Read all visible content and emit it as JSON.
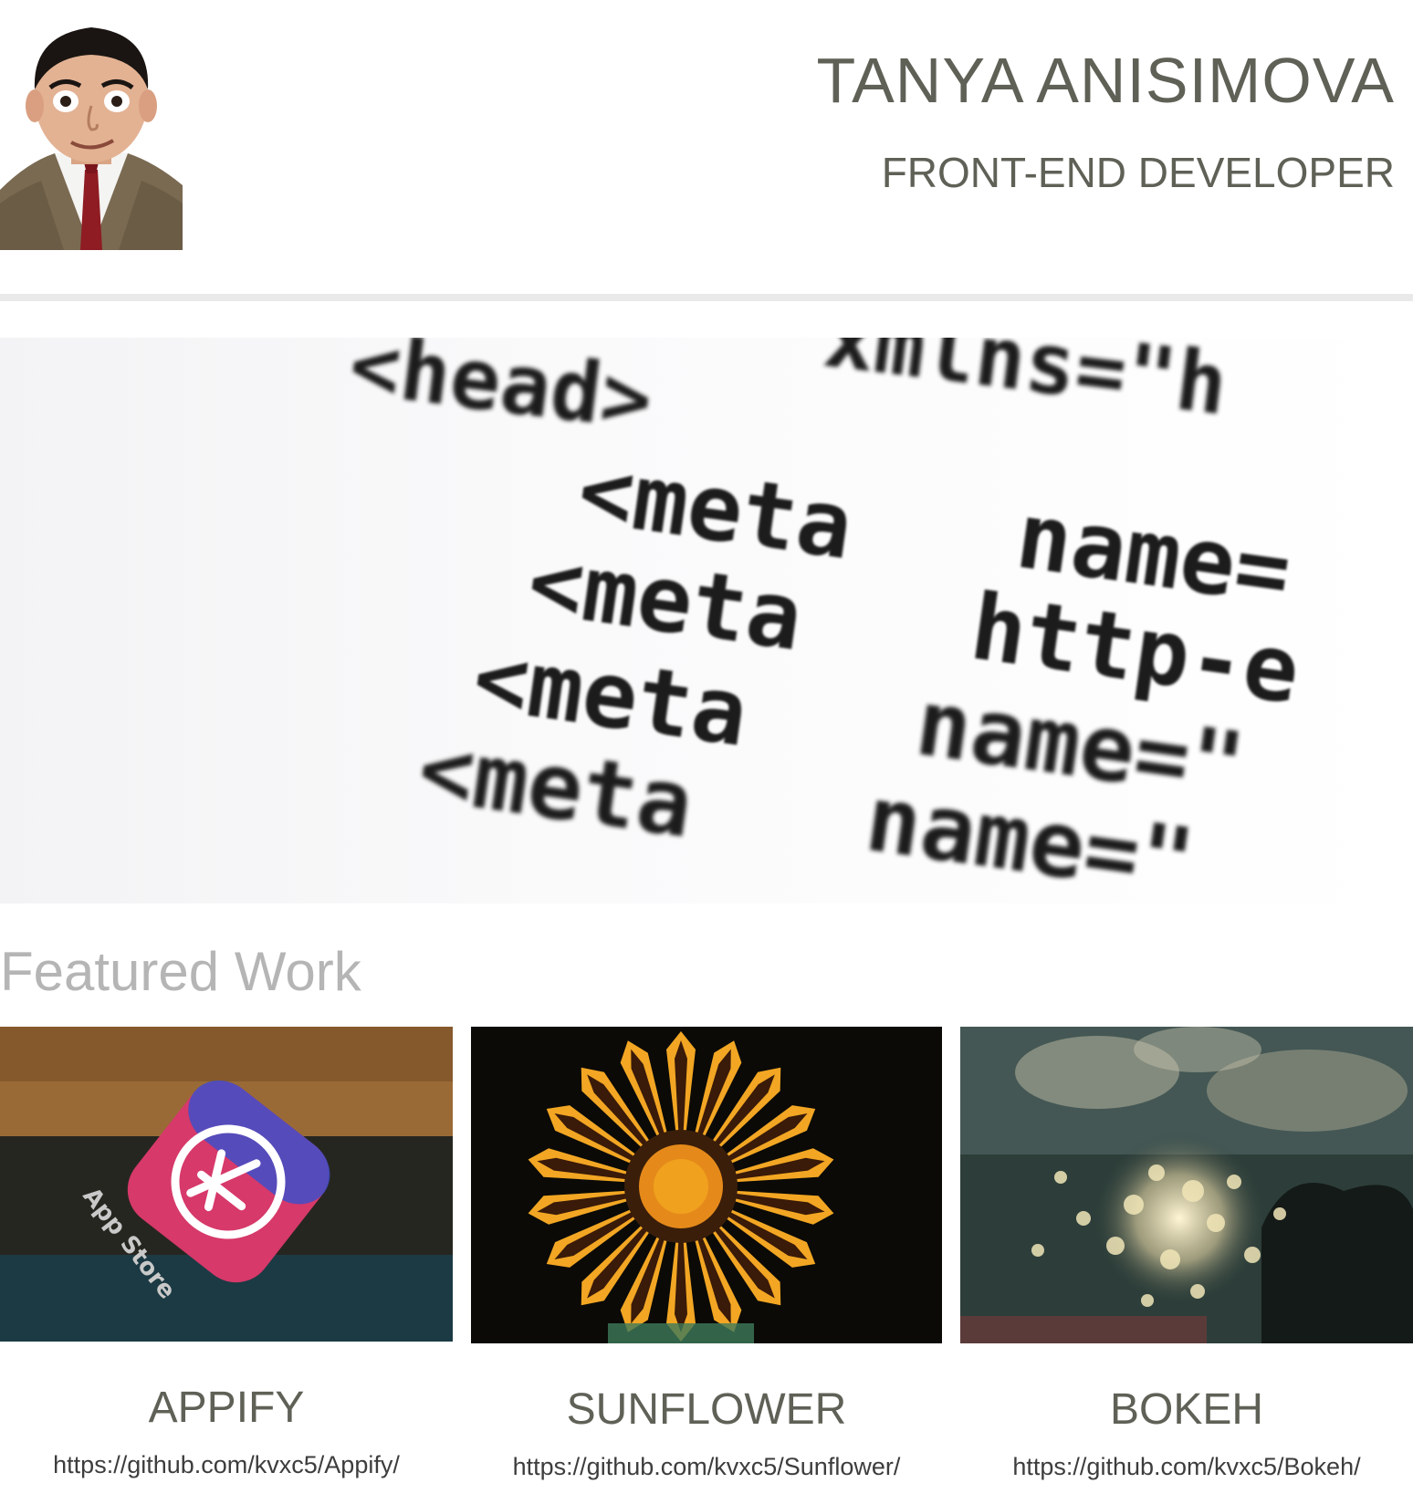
{
  "header": {
    "name": "TANYA ANISIMOVA",
    "role": "FRONT-END DEVELOPER",
    "avatar_icon": "profile-photo"
  },
  "hero": {
    "image_icon": "html-code-closeup-image",
    "code_lines": [
      "<head>",
      "xmlns=\"h",
      "<meta",
      "name=",
      "<meta",
      "http-e",
      "<meta",
      "name=\"",
      "<meta",
      "name=\""
    ]
  },
  "featured": {
    "title": "Featured Work",
    "projects": [
      {
        "title": "APPIFY",
        "link": "https://github.com/kvxc5/Appify/",
        "image_icon": "app-store-icon-image"
      },
      {
        "title": "SUNFLOWER",
        "link": "https://github.com/kvxc5/Sunflower/",
        "image_icon": "sunflower-image"
      },
      {
        "title": "BOKEH",
        "link": "https://github.com/kvxc5/Bokeh/",
        "image_icon": "bokeh-lights-image"
      }
    ]
  },
  "colors": {
    "heading_text": "#5f6157",
    "featured_title": "#b5b5b5",
    "divider": "#e9e9e9",
    "link_text": "#3d3d3d"
  }
}
